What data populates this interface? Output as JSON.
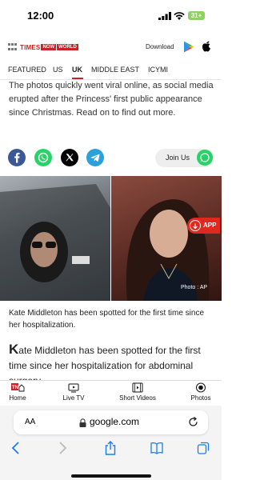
{
  "status_bar": {
    "time": "12:00",
    "battery": "31+"
  },
  "header": {
    "logo": {
      "times": "TIMES",
      "now": "NOW",
      "world": "WORLD"
    },
    "download_label": "Download",
    "icons": [
      "google-play-icon",
      "apple-icon"
    ]
  },
  "nav": {
    "tabs": [
      "FEATURED",
      "US",
      "UK",
      "MIDDLE EAST",
      "ICYMI"
    ],
    "active_tab": "UK"
  },
  "article": {
    "intro": "The photos quickly went viral online, as social media erupted after the Princess' first public appearance since Christmas. Read on to find out more.",
    "photo_credit": "Photo : AP",
    "caption": "Kate Middleton has been spotted for the first time since her hospitalization.",
    "body_dropcap": "K",
    "body_rest": "ate Middleton has been spotted for the first time since her hospitalization for abdominal surgery."
  },
  "share": {
    "icons": [
      "facebook-icon",
      "whatsapp-icon",
      "x-icon",
      "telegram-icon"
    ],
    "join_us_label": "Join Us"
  },
  "app_badge": {
    "label": "APP"
  },
  "bottom_nav": {
    "items": [
      {
        "label": "Home",
        "icon": "home-icon"
      },
      {
        "label": "Live TV",
        "icon": "tv-icon"
      },
      {
        "label": "Short Videos",
        "icon": "film-icon"
      },
      {
        "label": "Photos",
        "icon": "camera-icon"
      }
    ]
  },
  "browser": {
    "text_size_label": "AA",
    "domain": "google.com",
    "toolbar": [
      "back-icon",
      "forward-icon",
      "share-icon",
      "bookmarks-icon",
      "tabs-icon"
    ]
  }
}
